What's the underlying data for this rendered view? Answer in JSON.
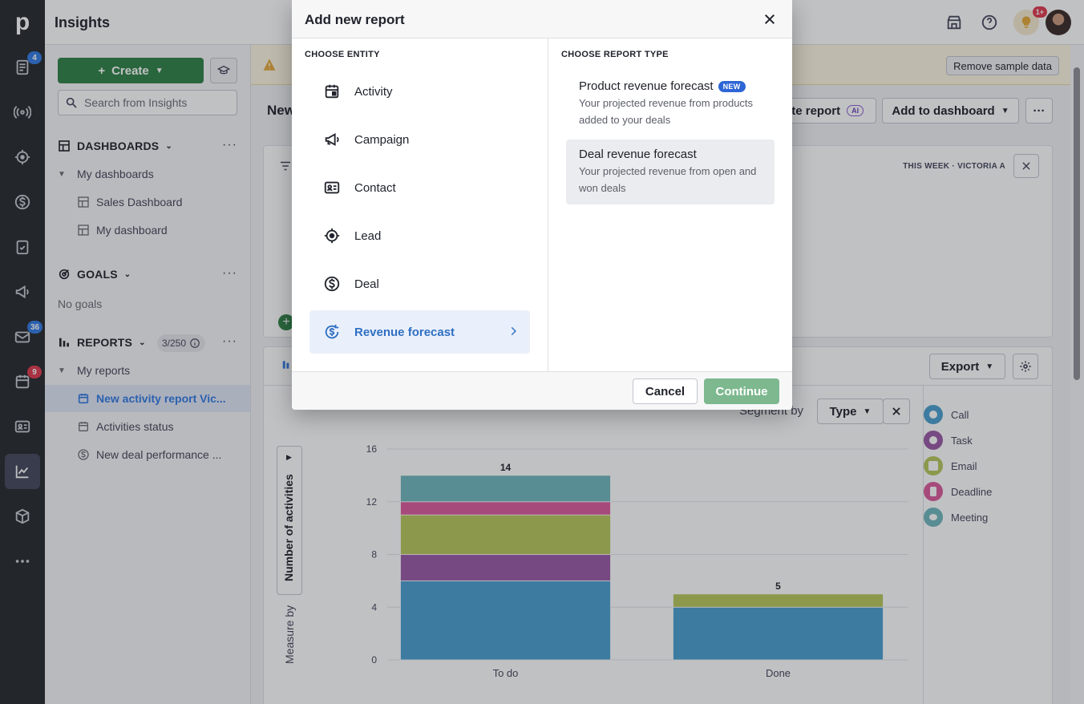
{
  "app": {
    "title": "Insights",
    "rail_badges": {
      "leads": "4",
      "mail": "36",
      "activities": "9"
    },
    "notifications_badge": "1+"
  },
  "sidebar": {
    "create_label": "Create",
    "search_placeholder": "Search from Insights",
    "dashboards_title": "DASHBOARDS",
    "my_dashboards_label": "My dashboards",
    "dashboards": [
      "Sales Dashboard",
      "My dashboard"
    ],
    "goals_title": "GOALS",
    "no_goals": "No goals",
    "reports_title": "REPORTS",
    "reports_counter": "3/250",
    "my_reports_label": "My reports",
    "reports": [
      "New activity report Vic...",
      "Activities status",
      "New deal performance ..."
    ]
  },
  "main": {
    "remove_sample": "Remove sample data",
    "report_title_partial": "New",
    "create_report_partial": "ate report",
    "ai_tag": "AI",
    "add_to_dashboard": "Add to dashboard",
    "filter_week": "THIS WEEK",
    "filter_user": "VICTORIA A",
    "export_label": "Export",
    "segment_by_label": "Segment by",
    "segment_value": "Type",
    "measure_by_label": "Measure by",
    "measure_value": "Number of activities"
  },
  "chart_data": {
    "type": "bar",
    "stacked": true,
    "categories": [
      "To do",
      "Done"
    ],
    "ylim": [
      0,
      16
    ],
    "yticks": [
      0,
      4,
      8,
      12,
      16
    ],
    "totals": [
      14,
      5
    ],
    "series": [
      {
        "name": "Call",
        "color": "#4a9fd0",
        "values": [
          6,
          4
        ]
      },
      {
        "name": "Task",
        "color": "#9a59a6",
        "values": [
          2,
          0
        ]
      },
      {
        "name": "Email",
        "color": "#b7c65a",
        "values": [
          3,
          1
        ]
      },
      {
        "name": "Deadline",
        "color": "#dc5a9b",
        "values": [
          1,
          0
        ]
      },
      {
        "name": "Meeting",
        "color": "#6fb7bd",
        "values": [
          2,
          0
        ]
      }
    ]
  },
  "legend": [
    {
      "name": "Call",
      "color": "#4a9fd0"
    },
    {
      "name": "Task",
      "color": "#9a59a6"
    },
    {
      "name": "Email",
      "color": "#b7c65a"
    },
    {
      "name": "Deadline",
      "color": "#dc5a9b"
    },
    {
      "name": "Meeting",
      "color": "#6fb7bd"
    }
  ],
  "modal": {
    "title": "Add new report",
    "entity_title": "CHOOSE ENTITY",
    "type_title": "CHOOSE REPORT TYPE",
    "entities": [
      "Activity",
      "Campaign",
      "Contact",
      "Lead",
      "Deal",
      "Revenue forecast"
    ],
    "report_types": [
      {
        "title": "Product revenue forecast",
        "tag": "NEW",
        "desc": "Your projected revenue from products added to your deals"
      },
      {
        "title": "Deal revenue forecast",
        "desc": "Your projected revenue from open and won deals"
      }
    ],
    "cancel": "Cancel",
    "continue": "Continue"
  }
}
